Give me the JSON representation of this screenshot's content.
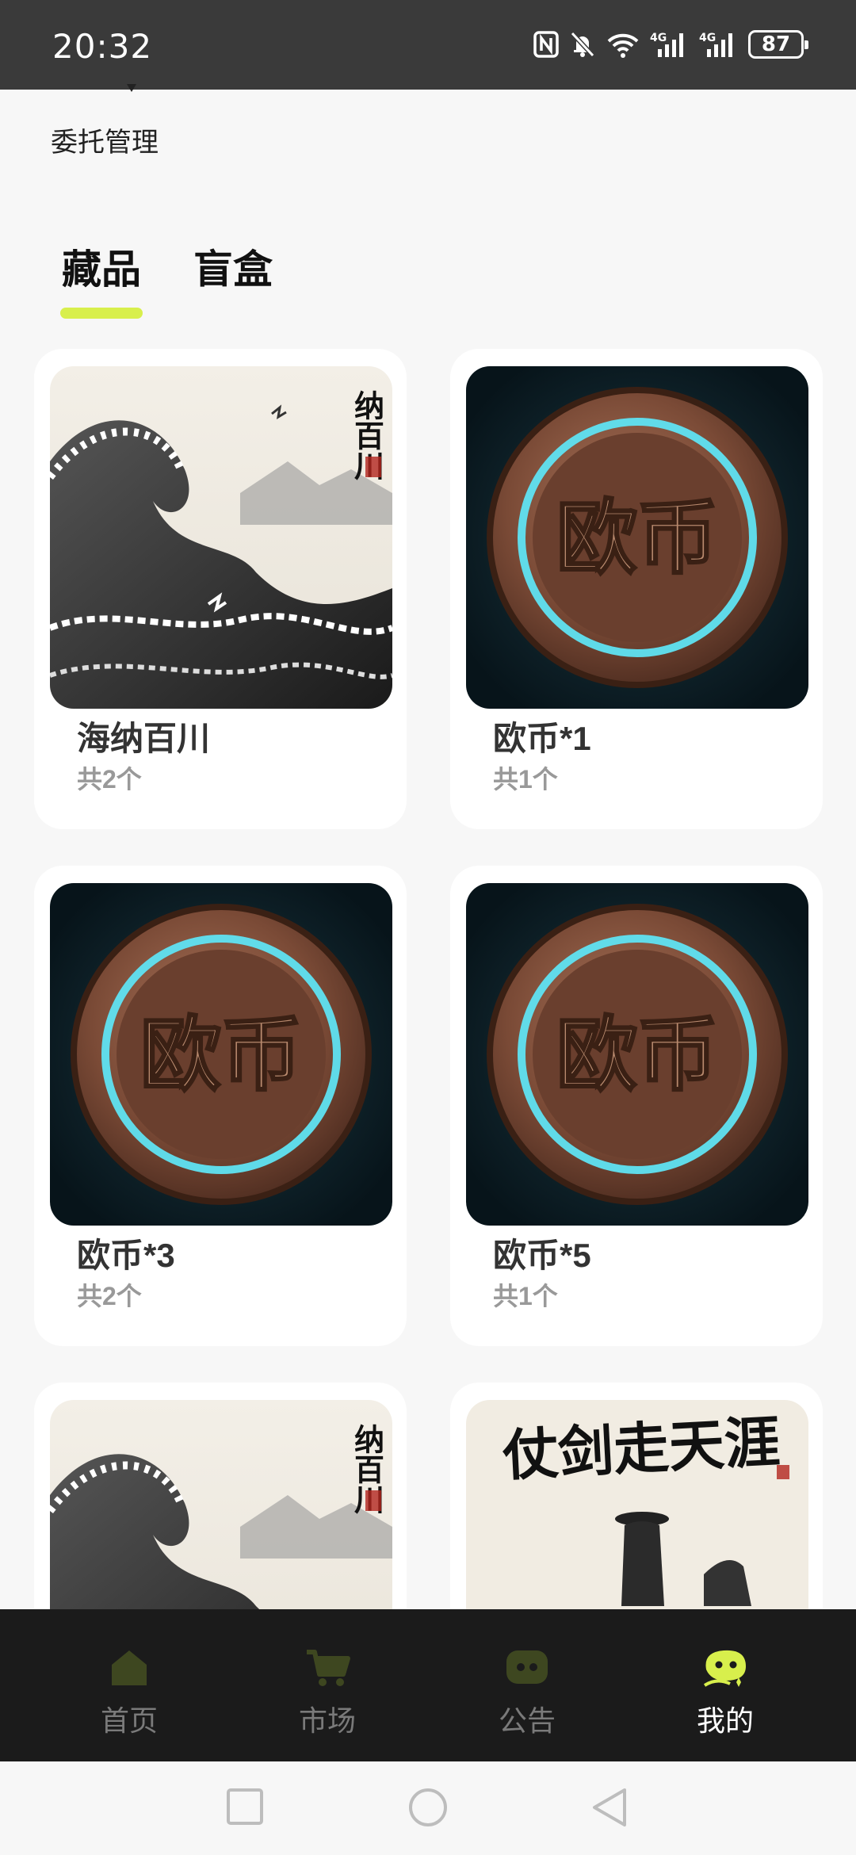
{
  "status_bar": {
    "time": "20:32",
    "battery": "87",
    "icons": [
      "nfc-icon",
      "mute-icon",
      "wifi-icon",
      "signal-4g-icon",
      "signal-4g-icon",
      "battery-icon"
    ]
  },
  "header": {
    "entrust_label": "委托管理"
  },
  "tabs": [
    {
      "label": "藏品",
      "active": true
    },
    {
      "label": "盲盒",
      "active": false
    }
  ],
  "accent_color": "#d8ef4c",
  "cards": [
    {
      "title": "海纳百川",
      "count": "共2个",
      "art": "ink-wave"
    },
    {
      "title": "欧币*1",
      "count": "共1个",
      "art": "coin"
    },
    {
      "title": "欧币*3",
      "count": "共2个",
      "art": "coin"
    },
    {
      "title": "欧币*5",
      "count": "共1个",
      "art": "coin"
    },
    {
      "title": "",
      "count": "",
      "art": "ink-wave"
    },
    {
      "title": "",
      "count": "",
      "art": "ink-swordsman"
    }
  ],
  "art_text": {
    "wave_calligraphy": "纳百川",
    "wave_seal": "海纳艺术",
    "coin_text": "欧币",
    "sword_calligraphy": "仗剑走天涯"
  },
  "bottom_nav": [
    {
      "label": "首页",
      "icon": "home-icon",
      "active": false
    },
    {
      "label": "市场",
      "icon": "cart-icon",
      "active": false
    },
    {
      "label": "公告",
      "icon": "message-icon",
      "active": false
    },
    {
      "label": "我的",
      "icon": "profile-icon",
      "active": true
    }
  ],
  "system_nav": [
    "recents-button",
    "home-button",
    "back-button"
  ]
}
